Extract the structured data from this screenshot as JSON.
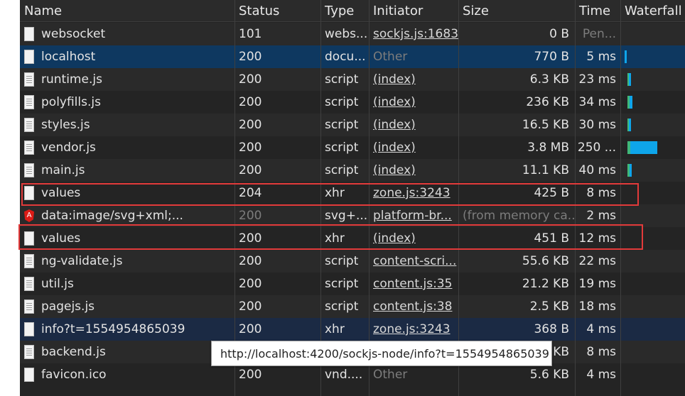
{
  "columns": {
    "name": "Name",
    "status": "Status",
    "type": "Type",
    "initiator": "Initiator",
    "size": "Size",
    "time": "Time",
    "waterfall": "Waterfall"
  },
  "rows": [
    {
      "name": "websocket",
      "status": "101",
      "type": "webs...",
      "initiator": "sockjs.js:1683",
      "size": "0 B",
      "time": "Pen..."
    },
    {
      "name": "localhost",
      "status": "200",
      "type": "docu...",
      "initiator": "Other",
      "size": "770 B",
      "time": "5 ms"
    },
    {
      "name": "runtime.js",
      "status": "200",
      "type": "script",
      "initiator": "(index)",
      "size": "6.3 KB",
      "time": "23 ms"
    },
    {
      "name": "polyfills.js",
      "status": "200",
      "type": "script",
      "initiator": "(index)",
      "size": "236 KB",
      "time": "34 ms"
    },
    {
      "name": "styles.js",
      "status": "200",
      "type": "script",
      "initiator": "(index)",
      "size": "16.5 KB",
      "time": "30 ms"
    },
    {
      "name": "vendor.js",
      "status": "200",
      "type": "script",
      "initiator": "(index)",
      "size": "3.8 MB",
      "time": "250 ..."
    },
    {
      "name": "main.js",
      "status": "200",
      "type": "script",
      "initiator": "(index)",
      "size": "11.1 KB",
      "time": "40 ms"
    },
    {
      "name": "values",
      "status": "204",
      "type": "xhr",
      "initiator": "zone.js:3243",
      "size": "425 B",
      "time": "8 ms"
    },
    {
      "name": "data:image/svg+xml;...",
      "status": "200",
      "type": "svg+...",
      "initiator": "platform-br...",
      "size": "(from memory ca...",
      "time": "2 ms"
    },
    {
      "name": "values",
      "status": "200",
      "type": "xhr",
      "initiator": "(index)",
      "size": "451 B",
      "time": "12 ms"
    },
    {
      "name": "ng-validate.js",
      "status": "200",
      "type": "script",
      "initiator": "content-scri...",
      "size": "55.6 KB",
      "time": "22 ms"
    },
    {
      "name": "util.js",
      "status": "200",
      "type": "script",
      "initiator": "content.js:35",
      "size": "21.2 KB",
      "time": "19 ms"
    },
    {
      "name": "pagejs.js",
      "status": "200",
      "type": "script",
      "initiator": "content.js:38",
      "size": "2.5 KB",
      "time": "18 ms"
    },
    {
      "name": "info?t=1554954865039",
      "status": "200",
      "type": "xhr",
      "initiator": "zone.js:3243",
      "size": "368 B",
      "time": "4 ms"
    },
    {
      "name": "backend.js",
      "status": "",
      "type": "",
      "initiator": "",
      "size": "KB",
      "time": "8 ms"
    },
    {
      "name": "favicon.ico",
      "status": "200",
      "type": "vnd....",
      "initiator": "Other",
      "size": "5.6 KB",
      "time": "4 ms"
    }
  ],
  "tooltip": "http://localhost:4200/sockjs-node/info?t=1554954865039",
  "colors": {
    "highlight_box": "#e23a3a",
    "selected_row": "#0e3860",
    "waterfall_bar": "#0ea5ea",
    "waterfall_wait": "#3fb87a"
  }
}
